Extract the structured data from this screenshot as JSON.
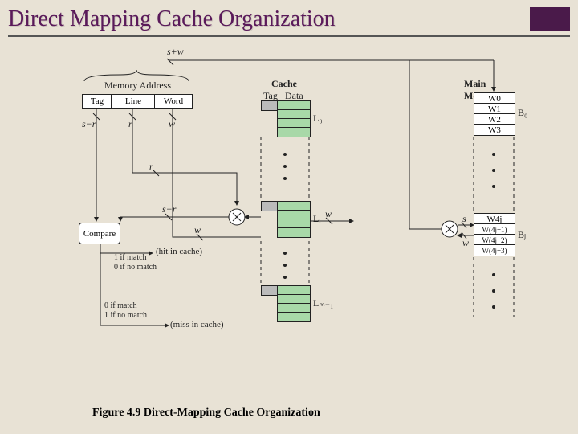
{
  "title": "Direct Mapping Cache Organization",
  "memory_address": {
    "header": "Memory Address",
    "fields": [
      "Tag",
      "Line",
      "Word"
    ]
  },
  "cache": {
    "header": "Cache",
    "columns": [
      "Tag",
      "Data"
    ]
  },
  "main_memory": {
    "header": "Main Memory"
  },
  "block_labels": {
    "L0": "L₀",
    "Li": "Lᵢ",
    "Lm1": "Lₘ₋₁",
    "B0": "B₀",
    "Bj": "Bⱼ"
  },
  "mem_words": {
    "w0": "W0",
    "w1": "W1",
    "w2": "W2",
    "w3": "W3",
    "w4j": "W4j",
    "w4j1": "W(4j+1)",
    "w4j2": "W(4j+2)",
    "w4j3": "W(4j+3)"
  },
  "compare": {
    "label": "Compare",
    "match1": "1 if match",
    "match0": "0 if no match",
    "miss0": "0 if match",
    "miss1": "1 if no match",
    "hit": "(hit in cache)",
    "miss": "(miss in cache)"
  },
  "signals": {
    "sw": "s+w",
    "s": "s",
    "w": "w",
    "sr": "s−r",
    "r": "r"
  },
  "figure_caption": "Figure 4.9   Direct-Mapping Cache Organization"
}
